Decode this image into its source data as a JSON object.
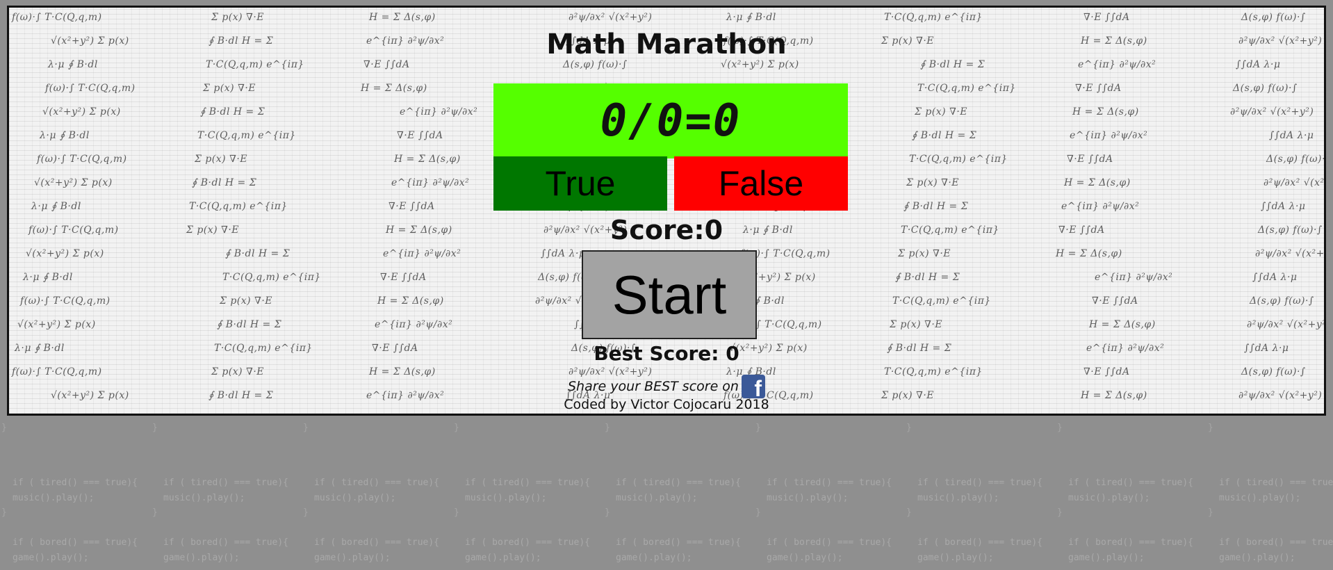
{
  "title": "Math Marathon",
  "equation": "0/0=0",
  "buttons": {
    "true_label": "True",
    "false_label": "False",
    "start_label": "Start"
  },
  "score_text": "Score:0",
  "best_score_text": "Best Score: 0",
  "share_text": "Share your BEST score on",
  "credit_text": "Coded by Victor Cojocaru 2018",
  "colors": {
    "equation_bg": "#55ff00",
    "true_bg": "#007700",
    "false_bg": "#ff0000",
    "start_bg": "#a3a3a3",
    "facebook": "#3b5998"
  },
  "icons": {
    "share": "facebook-icon"
  },
  "background_code": {
    "line1_prefix": "if ( ",
    "line1_tired": "tired",
    "line1_bored": "bored",
    "line1_suffix": "() === true){",
    "line2_tired": "music().play();",
    "line2_bored": "game().play();"
  }
}
